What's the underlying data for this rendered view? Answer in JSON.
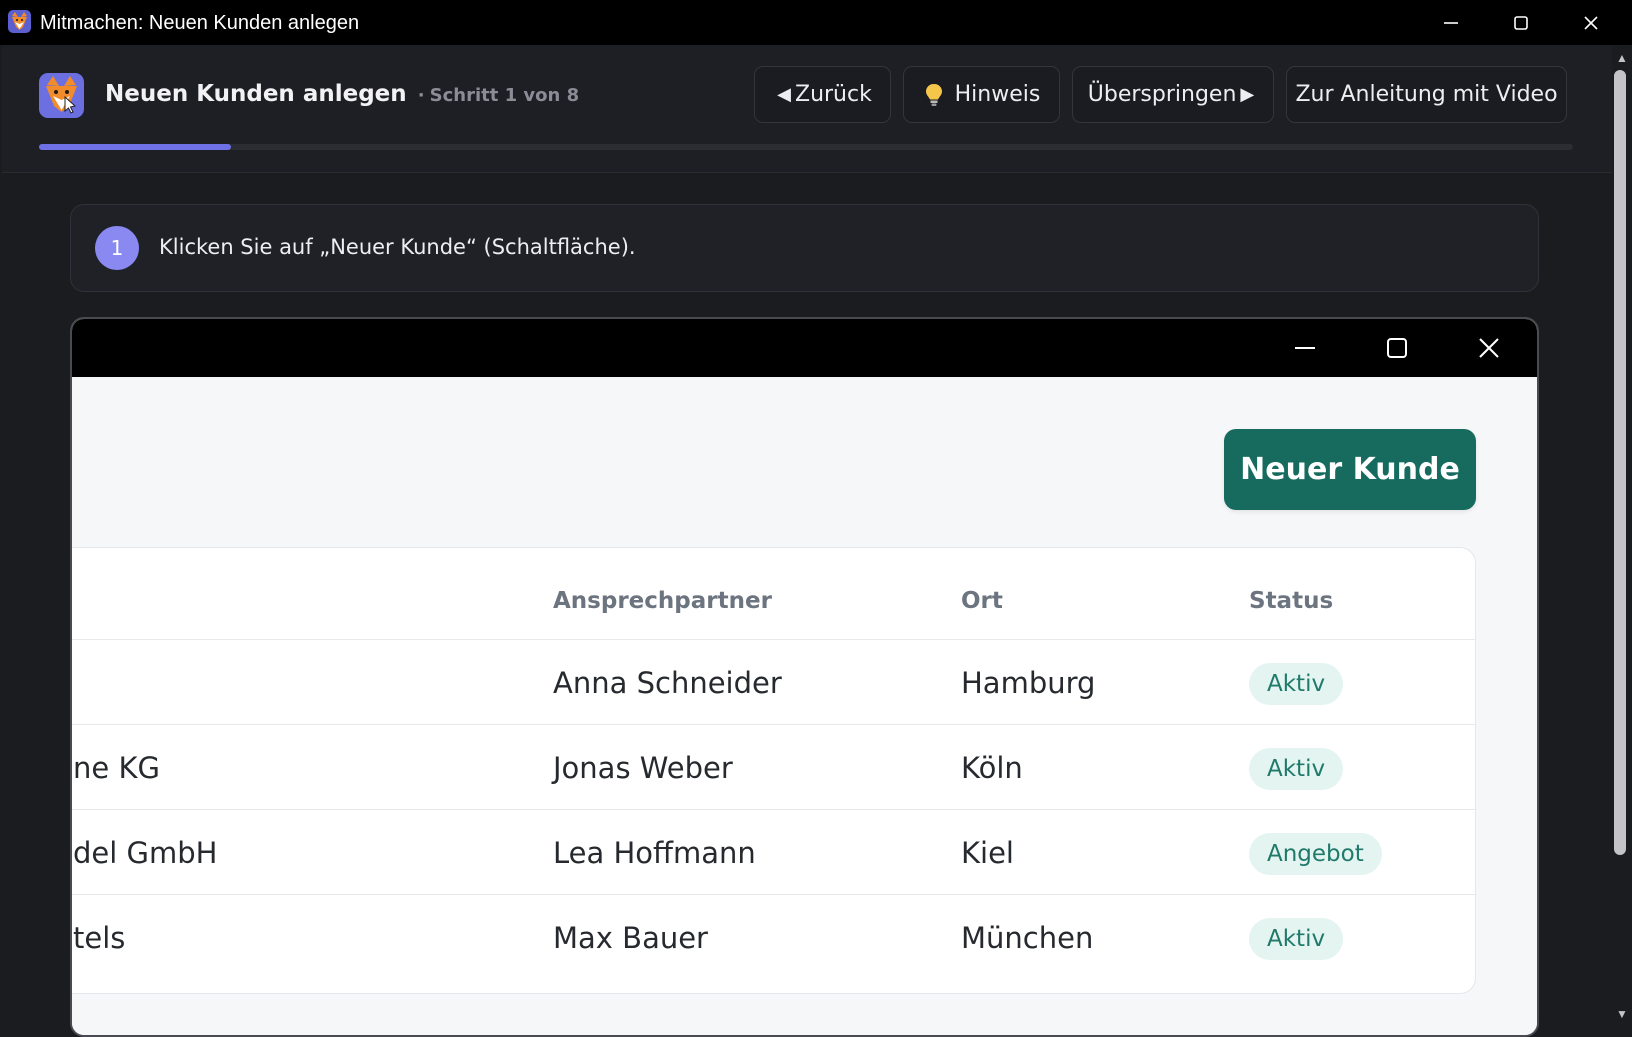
{
  "window": {
    "title": "Mitmachen: Neuen Kunden anlegen"
  },
  "header": {
    "title": "Neuen Kunden anlegen",
    "separator": "·",
    "step_text": "Schritt 1 von 8",
    "progress_fraction": 0.125,
    "buttons": {
      "back_glyph": "◀",
      "back_label": "Zurück",
      "hint_label": "Hinweis",
      "skip_label": "Überspringen",
      "skip_glyph": "▶",
      "video_label": "Zur Anleitung mit Video"
    }
  },
  "instruction": {
    "step_number": "1",
    "text": "Klicken Sie auf „Neuer Kunde“ (Schaltfläche)."
  },
  "embedded_app": {
    "primary_button_label": "Neuer Kunde",
    "table": {
      "headers": [
        "Ansprechpartner",
        "Ort",
        "Status"
      ],
      "rows": [
        {
          "company": "",
          "contact": "Anna Schneider",
          "city": "Hamburg",
          "status": "Aktiv"
        },
        {
          "company": "ne KG",
          "contact": "Jonas Weber",
          "city": "Köln",
          "status": "Aktiv"
        },
        {
          "company": "del GmbH",
          "contact": "Lea Hoffmann",
          "city": "Kiel",
          "status": "Angebot"
        },
        {
          "company": "tels",
          "contact": "Max Bauer",
          "city": "München",
          "status": "Aktiv"
        }
      ]
    }
  },
  "colors": {
    "accent": "#6e71e6",
    "primary_button": "#166b5e",
    "badge_bg": "#e4f4f1",
    "badge_text": "#207a6b"
  },
  "icons": {
    "app": "fox-icon",
    "hint": "lightbulb-icon"
  }
}
